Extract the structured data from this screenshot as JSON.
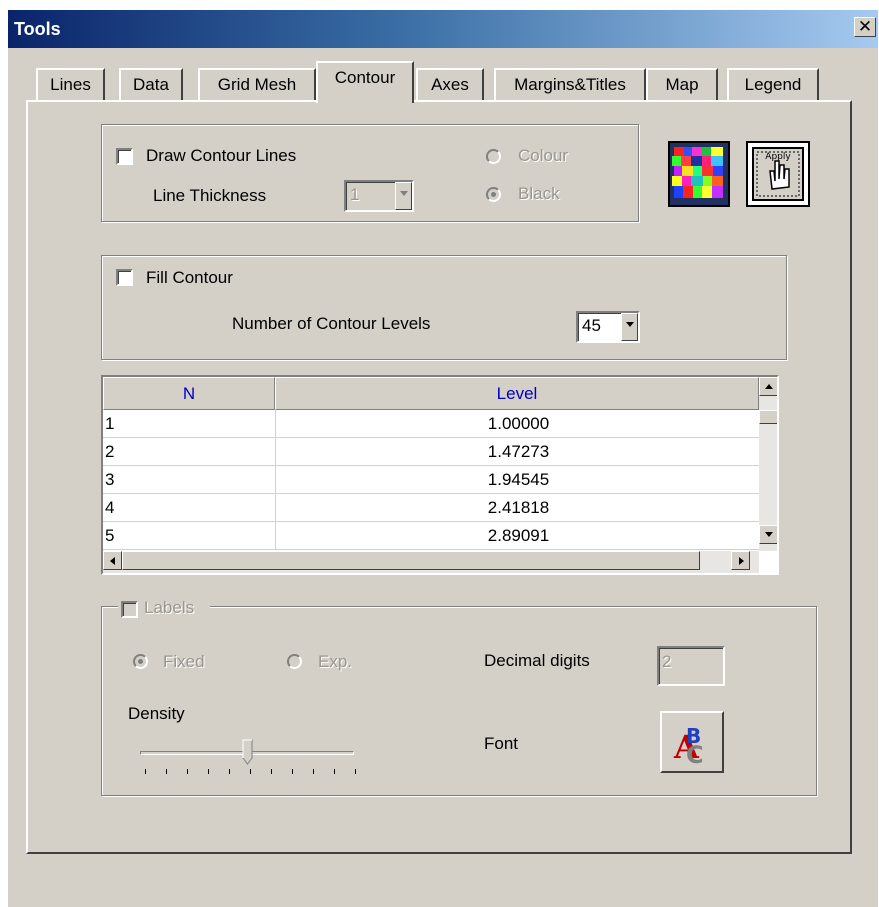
{
  "window": {
    "title": "Tools",
    "close_glyph": "✕"
  },
  "tabs": [
    {
      "label": "Lines"
    },
    {
      "label": "Data"
    },
    {
      "label": "Grid Mesh"
    },
    {
      "label": "Contour",
      "active": true
    },
    {
      "label": "Axes"
    },
    {
      "label": "Margins&Titles"
    },
    {
      "label": "Map"
    },
    {
      "label": "Legend"
    }
  ],
  "contour_lines": {
    "draw_label": "Draw Contour Lines",
    "draw_checked": false,
    "thickness_label": "Line Thickness",
    "thickness_value": "1",
    "colour_label": "Colour",
    "black_label": "Black",
    "selected_radio": "Black"
  },
  "icons": {
    "palette": "colour-palette-icon",
    "apply": "apply-hand-icon",
    "font": "font-abc-icon"
  },
  "fill": {
    "label": "Fill Contour",
    "checked": false,
    "levels_label": "Number of Contour Levels",
    "levels_value": "45"
  },
  "table": {
    "columns": [
      "N",
      "Level"
    ],
    "rows": [
      {
        "n": "1",
        "level": "1.00000"
      },
      {
        "n": "2",
        "level": "1.47273"
      },
      {
        "n": "3",
        "level": "1.94545"
      },
      {
        "n": "4",
        "level": "2.41818"
      },
      {
        "n": "5",
        "level": "2.89091"
      }
    ]
  },
  "labels_group": {
    "title": "Labels",
    "fixed_label": "Fixed",
    "exp_label": "Exp.",
    "selected": "Fixed",
    "decimal_label": "Decimal digits",
    "decimal_value": "2",
    "density_label": "Density",
    "density_value": 0.5,
    "font_label": "Font"
  }
}
